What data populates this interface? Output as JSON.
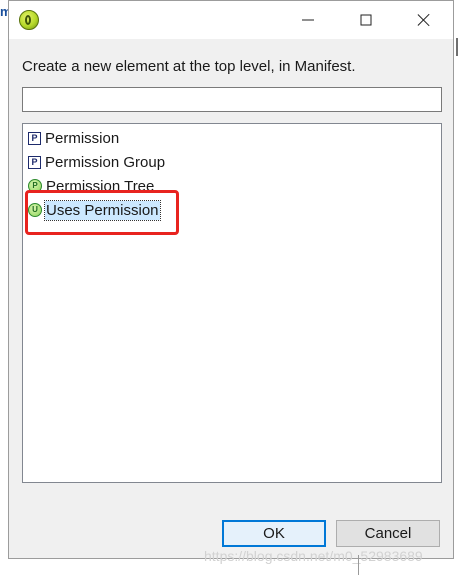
{
  "background": {
    "left_glyph": "m"
  },
  "dialog": {
    "app_icon": "eclipse-android-icon",
    "controls": {
      "minimize_icon": "minimize-icon",
      "maximize_icon": "maximize-icon",
      "close_icon": "close-icon"
    },
    "prompt": "Create a new element at the top level, in Manifest.",
    "filter": {
      "value": "",
      "placeholder": ""
    },
    "elements": [
      {
        "icon": "P",
        "label": "Permission",
        "selected": false
      },
      {
        "icon": "P",
        "label": "Permission Group",
        "selected": false
      },
      {
        "icon": "P",
        "label": "Permission Tree",
        "selected": false
      },
      {
        "icon": "U",
        "label": "Uses Permission",
        "selected": true
      }
    ],
    "buttons": {
      "ok": "OK",
      "cancel": "Cancel"
    }
  },
  "annotation": {
    "color": "#e8231f"
  },
  "watermark": "https://blog.csdn.net/m0_52983689",
  "colors": {
    "selection": "#cce8ff",
    "primary_border": "#0078d7"
  }
}
